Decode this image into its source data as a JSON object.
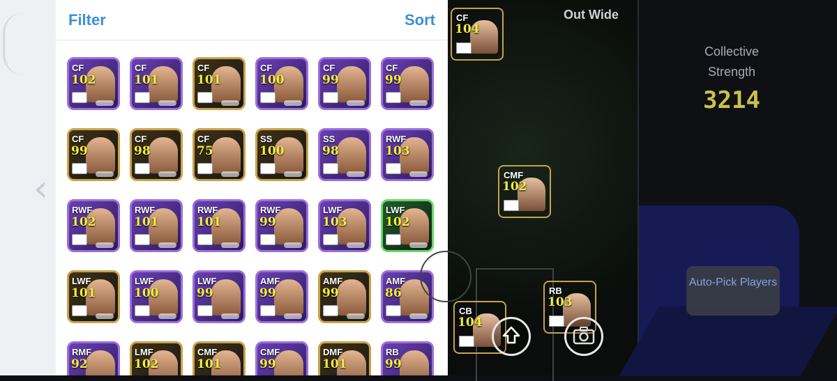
{
  "panel": {
    "filter_label": "Filter",
    "sort_label": "Sort"
  },
  "grid": [
    {
      "pos": "CF",
      "ovr": "102",
      "frame": "purple"
    },
    {
      "pos": "CF",
      "ovr": "101",
      "frame": "purple"
    },
    {
      "pos": "CF",
      "ovr": "101",
      "frame": "gold"
    },
    {
      "pos": "CF",
      "ovr": "100",
      "frame": "purple"
    },
    {
      "pos": "CF",
      "ovr": "99",
      "frame": "purple"
    },
    {
      "pos": "CF",
      "ovr": "99",
      "frame": "purple"
    },
    {
      "pos": "CF",
      "ovr": "99",
      "frame": "gold"
    },
    {
      "pos": "CF",
      "ovr": "98",
      "frame": "gold"
    },
    {
      "pos": "CF",
      "ovr": "75",
      "frame": "gold"
    },
    {
      "pos": "SS",
      "ovr": "100",
      "frame": "gold"
    },
    {
      "pos": "SS",
      "ovr": "98",
      "frame": "purple"
    },
    {
      "pos": "RWF",
      "ovr": "103",
      "frame": "purple"
    },
    {
      "pos": "RWF",
      "ovr": "102",
      "frame": "purple"
    },
    {
      "pos": "RWF",
      "ovr": "101",
      "frame": "purple"
    },
    {
      "pos": "RWF",
      "ovr": "101",
      "frame": "purple"
    },
    {
      "pos": "RWF",
      "ovr": "99",
      "frame": "purple"
    },
    {
      "pos": "LWF",
      "ovr": "103",
      "frame": "purple"
    },
    {
      "pos": "LWF",
      "ovr": "102",
      "frame": "green"
    },
    {
      "pos": "LWF",
      "ovr": "101",
      "frame": "gold"
    },
    {
      "pos": "LWF",
      "ovr": "100",
      "frame": "purple"
    },
    {
      "pos": "LWF",
      "ovr": "99",
      "frame": "purple"
    },
    {
      "pos": "AMF",
      "ovr": "99",
      "frame": "purple"
    },
    {
      "pos": "AMF",
      "ovr": "99",
      "frame": "gold"
    },
    {
      "pos": "AMF",
      "ovr": "86",
      "frame": "purple"
    },
    {
      "pos": "RMF",
      "ovr": "92",
      "frame": "purple"
    },
    {
      "pos": "LMF",
      "ovr": "102",
      "frame": "gold"
    },
    {
      "pos": "CMF",
      "ovr": "101",
      "frame": "gold"
    },
    {
      "pos": "CMF",
      "ovr": "99",
      "frame": "purple"
    },
    {
      "pos": "DMF",
      "ovr": "101",
      "frame": "gold"
    },
    {
      "pos": "RB",
      "ovr": "99",
      "frame": "purple"
    }
  ],
  "pitch": {
    "title": "Out Wide",
    "players": [
      {
        "pos": "CF",
        "ovr": "104"
      },
      {
        "pos": "CMF",
        "ovr": "102"
      },
      {
        "pos": "RB",
        "ovr": "103"
      },
      {
        "pos": "CB",
        "ovr": "104"
      }
    ]
  },
  "side": {
    "collective_label": "Collective Strength",
    "collective_value": "3214",
    "autopick_label": "Auto-Pick Players"
  },
  "colors": {
    "accent": "#3a8fd8",
    "rating": "#f4ee3b",
    "strength": "#c9c24a"
  }
}
